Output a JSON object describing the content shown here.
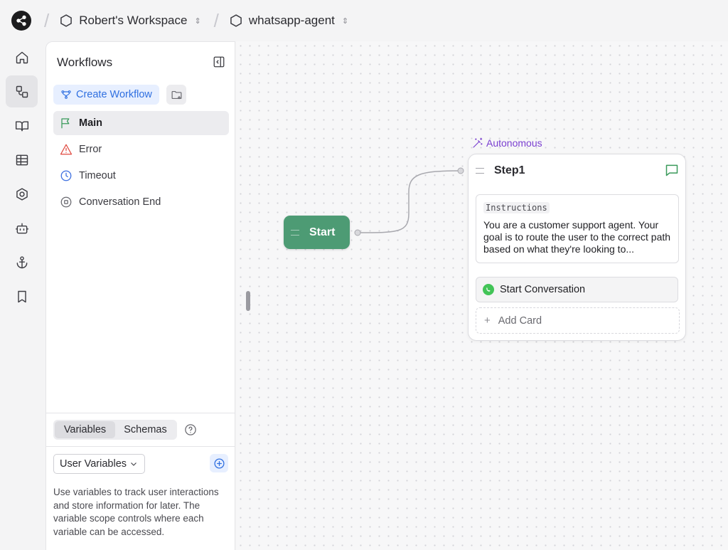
{
  "topbar": {
    "workspace": "Robert's Workspace",
    "project": "whatsapp-agent"
  },
  "rail": {
    "items": [
      "home-icon",
      "workflows-icon",
      "book-icon",
      "table-icon",
      "settings-hex-icon",
      "bot-icon",
      "anchor-icon",
      "bookmark-icon"
    ],
    "active": "workflows-icon"
  },
  "panel": {
    "title": "Workflows",
    "create_label": "Create Workflow",
    "items": [
      {
        "label": "Main",
        "icon": "flag-icon",
        "color": "#3a9a5b"
      },
      {
        "label": "Error",
        "icon": "warning-icon",
        "color": "#e0483e"
      },
      {
        "label": "Timeout",
        "icon": "clock-icon",
        "color": "#3d6fe0"
      },
      {
        "label": "Conversation End",
        "icon": "stop-circle-icon",
        "color": "#6a6a70"
      }
    ],
    "tabs": [
      "Variables",
      "Schemas"
    ],
    "select_value": "User Variables",
    "description": "Use variables to track user interactions and store information for later. The variable scope controls where each variable can be accessed."
  },
  "canvas": {
    "start_label": "Start",
    "step": {
      "mode_label": "Autonomous",
      "title": "Step1",
      "instructions_tag": "Instructions",
      "instructions_text": "You are a customer support agent. Your goal is to route the user to the correct path based on what they're looking to...",
      "card_label": "Start Conversation",
      "add_card_label": "Add Card"
    }
  },
  "colors": {
    "start_node": "#4d9b74",
    "accent_blue": "#2f6fe0",
    "autonomous": "#7a3fd0",
    "whatsapp": "#42c457"
  }
}
